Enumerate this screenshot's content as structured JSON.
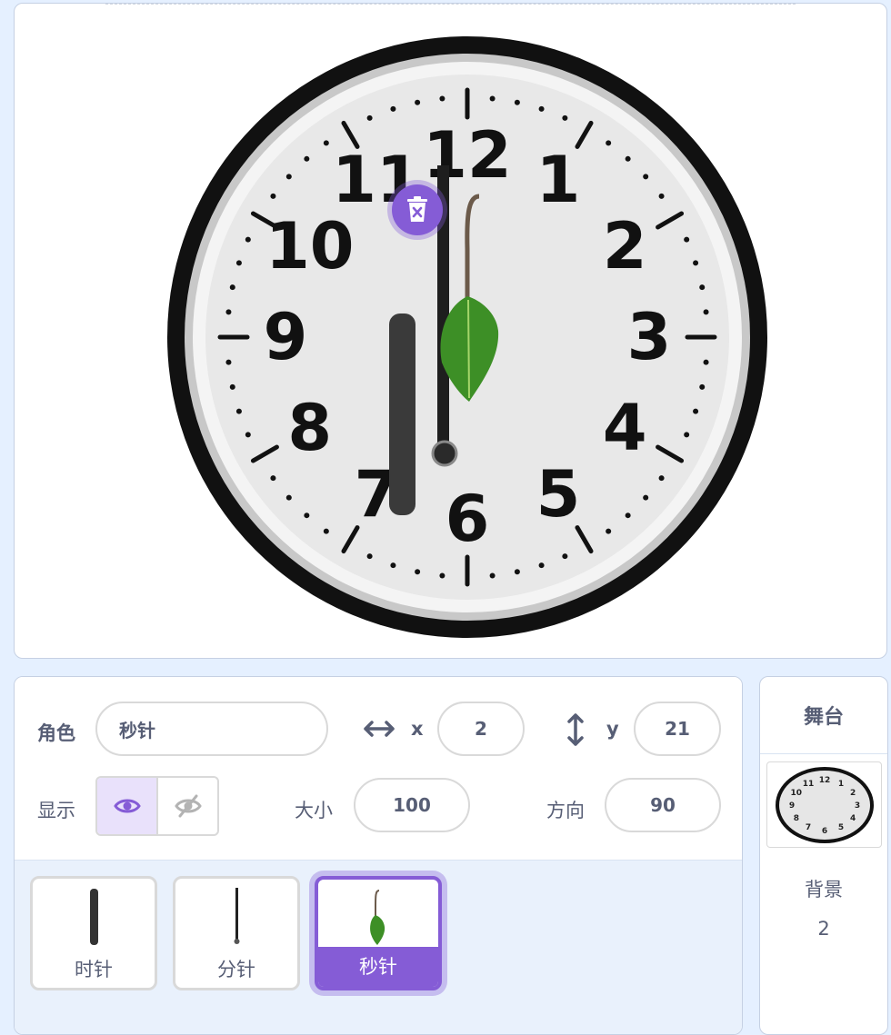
{
  "stage": {
    "clock_numbers": [
      "12",
      "1",
      "2",
      "3",
      "4",
      "5",
      "6",
      "7",
      "8",
      "9",
      "10",
      "11"
    ]
  },
  "sprite_info": {
    "sprite_label": "角色",
    "sprite_name": "秒针",
    "x_label": "x",
    "x_value": "2",
    "y_label": "y",
    "y_value": "21",
    "show_label": "显示",
    "size_label": "大小",
    "size_value": "100",
    "direction_label": "方向",
    "direction_value": "90",
    "visible": true
  },
  "sprites": [
    {
      "name": "时针",
      "selected": false
    },
    {
      "name": "分针",
      "selected": false
    },
    {
      "name": "秒针",
      "selected": true
    }
  ],
  "stage_panel": {
    "title": "舞台",
    "backdrops_label": "背景",
    "backdrop_count": "2"
  },
  "colors": {
    "accent": "#855cd6",
    "text": "#575e75",
    "panel_bg": "#e5f0ff"
  }
}
